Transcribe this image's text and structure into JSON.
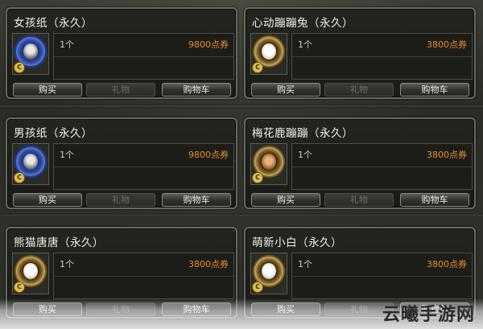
{
  "shop": {
    "items": [
      {
        "name": "女孩纸（永久）",
        "qty": "1个",
        "price": "9800点券",
        "icon": "blue-ring-girl-icon",
        "ring": "blue",
        "face": ""
      },
      {
        "name": "心动蹦蹦兔（永久）",
        "qty": "1个",
        "price": "3800点券",
        "icon": "gold-ring-rabbit-icon",
        "ring": "gold",
        "face": "face-white"
      },
      {
        "name": "男孩纸（永久）",
        "qty": "1个",
        "price": "9800点券",
        "icon": "blue-ring-boy-icon",
        "ring": "blue",
        "face": ""
      },
      {
        "name": "梅花鹿蹦蹦（永久）",
        "qty": "1个",
        "price": "3800点券",
        "icon": "gold-ring-deer-icon",
        "ring": "gold",
        "face": "face-brown"
      },
      {
        "name": "熊猫唐唐（永久）",
        "qty": "1个",
        "price": "3800点券",
        "icon": "gold-ring-panda-icon",
        "ring": "gold",
        "face": "face-white"
      },
      {
        "name": "萌新小白（永久）",
        "qty": "1个",
        "price": "3800点券",
        "icon": "gold-ring-white-pet-icon",
        "ring": "gold",
        "face": "face-white"
      }
    ],
    "buttons": {
      "buy": "购买",
      "gift": "礼物",
      "cart": "购物车"
    },
    "badge_glyph": "C"
  },
  "watermark": {
    "text": "云曦手游网"
  },
  "colors": {
    "price": "#ef8a2c",
    "card_border": "#6a6a62"
  }
}
